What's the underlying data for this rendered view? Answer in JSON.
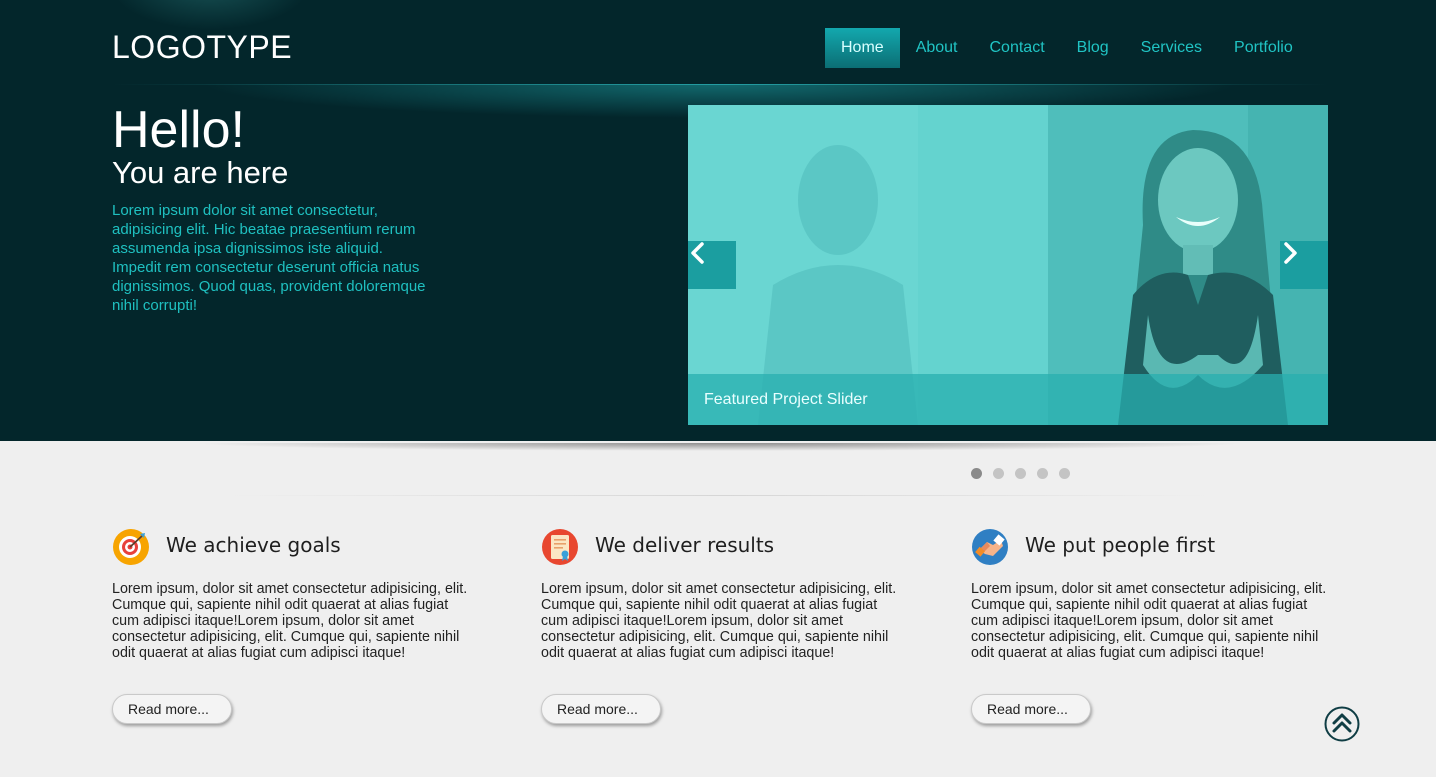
{
  "header": {
    "logo": "LOGOTYPE",
    "nav": [
      {
        "label": "Home",
        "active": true
      },
      {
        "label": "About",
        "active": false
      },
      {
        "label": "Contact",
        "active": false
      },
      {
        "label": "Blog",
        "active": false
      },
      {
        "label": "Services",
        "active": false
      },
      {
        "label": "Portfolio",
        "active": false
      }
    ]
  },
  "hero": {
    "title": "Hello!",
    "subtitle": "You are here",
    "text": "Lorem ipsum dolor sit amet consectetur, adipisicing elit. Hic beatae praesentium rerum assumenda ipsa dignissimos iste aliquid. Impedit rem consectetur deserunt officia natus dignissimos. Quod quas, provident doloremque nihil corrupti!"
  },
  "slider": {
    "caption": "Featured Project Slider",
    "prev_icon": "chevron-left-icon",
    "next_icon": "chevron-right-icon",
    "slide_count": 5,
    "active_slide": 1
  },
  "features": [
    {
      "icon": "target-icon",
      "title": "We achieve goals",
      "text": "Lorem ipsum, dolor sit amet consectetur adipisicing, elit. Cumque qui, sapiente nihil odit quaerat at alias fugiat cum adipisci itaque!Lorem ipsum, dolor sit amet consectetur adipisicing, elit. Cumque qui, sapiente nihil odit quaerat at alias fugiat cum adipisci itaque!",
      "button": "Read more..."
    },
    {
      "icon": "certificate-icon",
      "title": "We deliver results",
      "text": "Lorem ipsum, dolor sit amet consectetur adipisicing, elit. Cumque qui, sapiente nihil odit quaerat at alias fugiat cum adipisci itaque!Lorem ipsum, dolor sit amet consectetur adipisicing, elit. Cumque qui, sapiente nihil odit quaerat at alias fugiat cum adipisci itaque!",
      "button": "Read more..."
    },
    {
      "icon": "handshake-icon",
      "title": "We put people first",
      "text": "Lorem ipsum, dolor sit amet consectetur adipisicing, elit. Cumque qui, sapiente nihil odit quaerat at alias fugiat cum adipisci itaque!Lorem ipsum, dolor sit amet consectetur adipisicing, elit. Cumque qui, sapiente nihil odit quaerat at alias fugiat cum adipisci itaque!",
      "button": "Read more..."
    }
  ],
  "back_to_top_icon": "double-chevron-up-icon",
  "colors": {
    "hero_bg": "#03262b",
    "accent": "#1fc0c0",
    "nav_active": "#13a8ae",
    "page_bg": "#efefef"
  }
}
